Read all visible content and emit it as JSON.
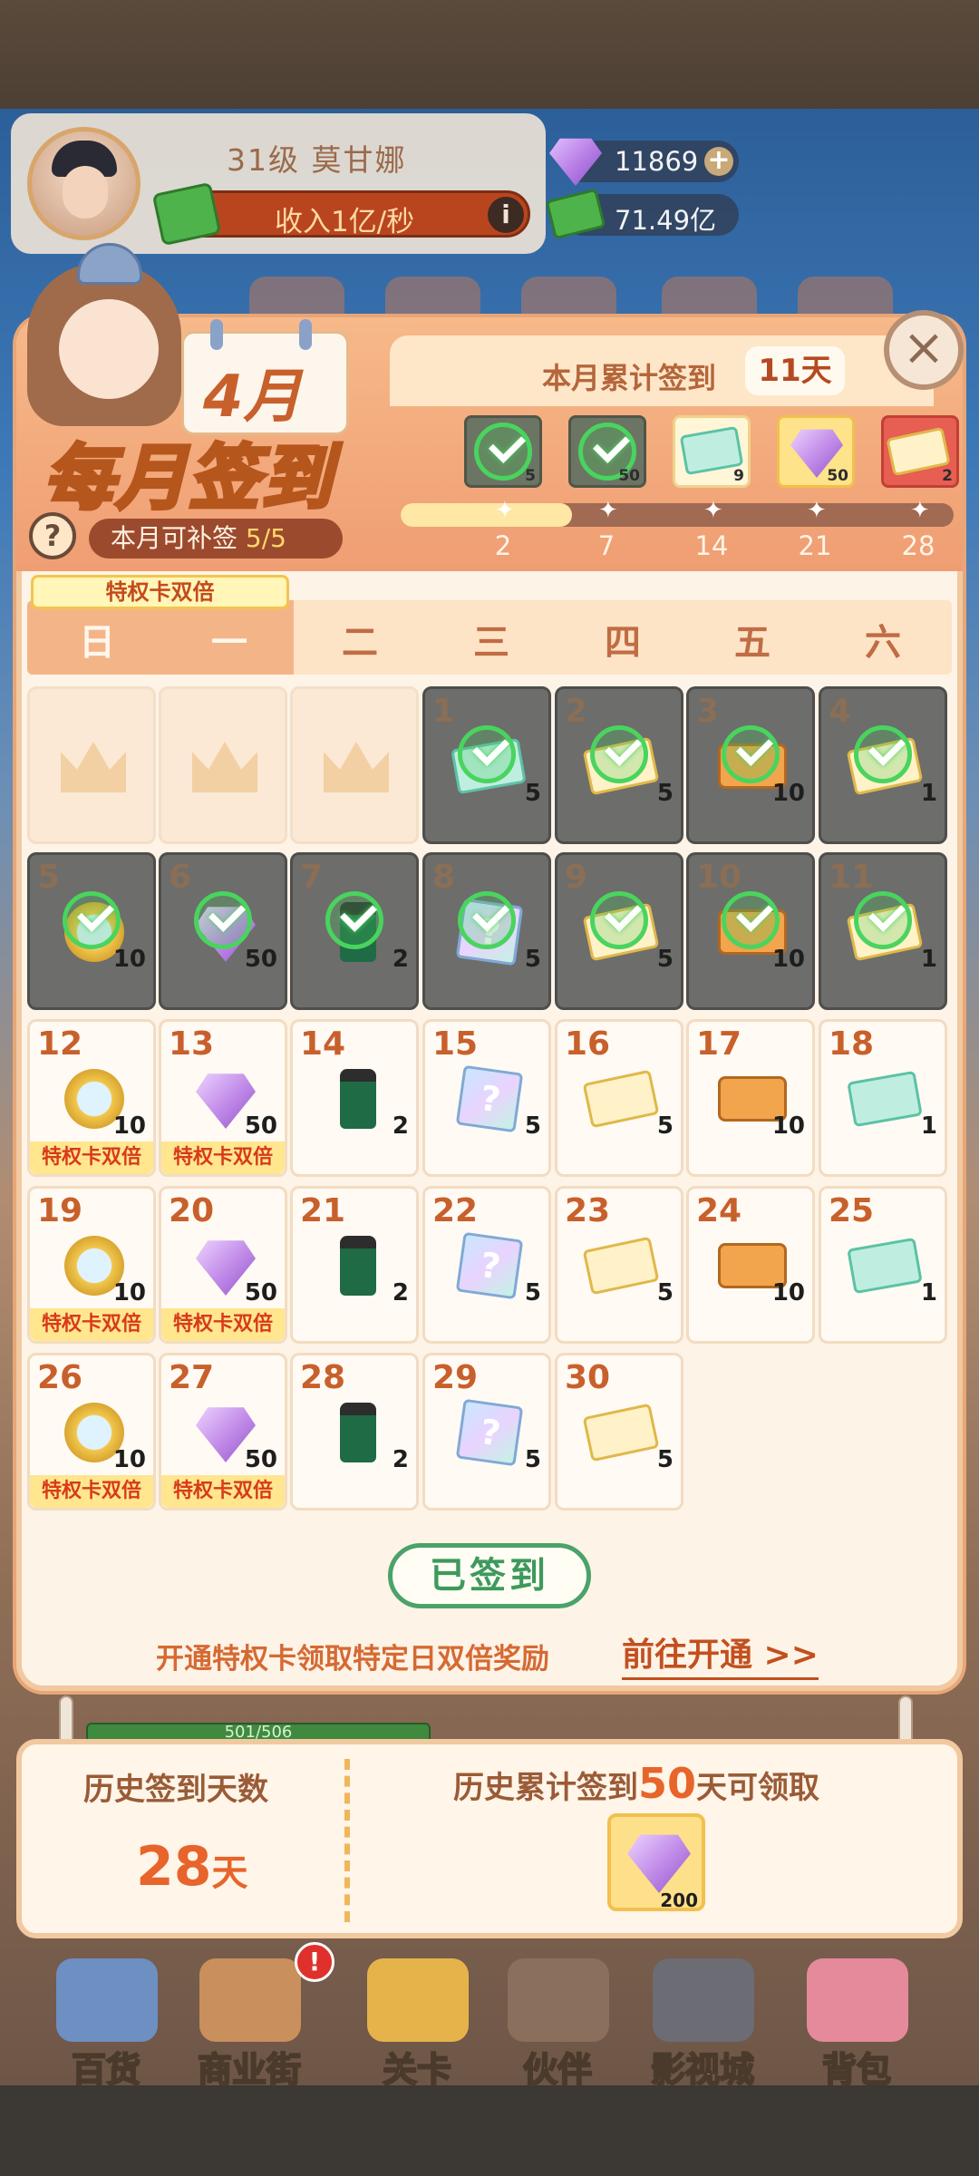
{
  "profile": {
    "level_name": "31级   莫甘娜",
    "income": "收入1亿/秒",
    "gems": "11869",
    "cash": "71.49亿"
  },
  "dialog": {
    "month": "4月",
    "title": "每月签到",
    "accum_label": "本月累计签到",
    "accum_days": "11天",
    "makeup_label": "本月可补签",
    "makeup_count": "5/5",
    "privilege_tag": "特权卡双倍",
    "close_icon": "×",
    "help_icon": "?"
  },
  "milestones": [
    {
      "day": "2",
      "count": "5",
      "type": "done"
    },
    {
      "day": "7",
      "count": "50",
      "type": "done"
    },
    {
      "day": "14",
      "count": "9",
      "type": "ticket"
    },
    {
      "day": "21",
      "count": "50",
      "type": "gem"
    },
    {
      "day": "28",
      "count": "2",
      "type": "red"
    }
  ],
  "progress": {
    "fraction": 0.31
  },
  "weekdays": [
    "日",
    "一",
    "二",
    "三",
    "四",
    "五",
    "六"
  ],
  "calendar": [
    {
      "day": "",
      "item": "crown",
      "qty": "",
      "state": "empty"
    },
    {
      "day": "",
      "item": "crown",
      "qty": "",
      "state": "empty"
    },
    {
      "day": "",
      "item": "crown",
      "qty": "",
      "state": "empty"
    },
    {
      "day": "1",
      "item": "cash-icon",
      "qty": "5",
      "state": "signed"
    },
    {
      "day": "2",
      "item": "ticket-icon",
      "qty": "5",
      "state": "signed"
    },
    {
      "day": "3",
      "item": "bento-icon",
      "qty": "10",
      "state": "signed"
    },
    {
      "day": "4",
      "item": "ticket-icon",
      "qty": "1",
      "state": "signed"
    },
    {
      "day": "5",
      "item": "clock-icon",
      "qty": "10",
      "state": "signed"
    },
    {
      "day": "6",
      "item": "gem-icon",
      "qty": "50",
      "state": "signed"
    },
    {
      "day": "7",
      "item": "bottle-icon",
      "qty": "2",
      "state": "signed"
    },
    {
      "day": "8",
      "item": "card-icon",
      "qty": "5",
      "state": "signed"
    },
    {
      "day": "9",
      "item": "ticket-icon",
      "qty": "5",
      "state": "signed"
    },
    {
      "day": "10",
      "item": "bento-icon",
      "qty": "10",
      "state": "signed"
    },
    {
      "day": "11",
      "item": "ticket-icon",
      "qty": "1",
      "state": "signed"
    },
    {
      "day": "12",
      "item": "clock-icon",
      "qty": "10",
      "state": "priv"
    },
    {
      "day": "13",
      "item": "gem-icon",
      "qty": "50",
      "state": "priv"
    },
    {
      "day": "14",
      "item": "bottle-icon",
      "qty": "2",
      "state": "open"
    },
    {
      "day": "15",
      "item": "card-icon",
      "qty": "5",
      "state": "open"
    },
    {
      "day": "16",
      "item": "ticket-icon",
      "qty": "5",
      "state": "open"
    },
    {
      "day": "17",
      "item": "bento-icon",
      "qty": "10",
      "state": "open"
    },
    {
      "day": "18",
      "item": "teal-ticket-icon",
      "qty": "1",
      "state": "open"
    },
    {
      "day": "19",
      "item": "clock-icon",
      "qty": "10",
      "state": "priv"
    },
    {
      "day": "20",
      "item": "gem-icon",
      "qty": "50",
      "state": "priv"
    },
    {
      "day": "21",
      "item": "bottle-icon",
      "qty": "2",
      "state": "open"
    },
    {
      "day": "22",
      "item": "card-icon",
      "qty": "5",
      "state": "open"
    },
    {
      "day": "23",
      "item": "ticket-icon",
      "qty": "5",
      "state": "open"
    },
    {
      "day": "24",
      "item": "bento-icon",
      "qty": "10",
      "state": "open"
    },
    {
      "day": "25",
      "item": "teal-ticket-icon",
      "qty": "1",
      "state": "open"
    },
    {
      "day": "26",
      "item": "clock-icon",
      "qty": "10",
      "state": "priv"
    },
    {
      "day": "27",
      "item": "gem-icon",
      "qty": "50",
      "state": "priv"
    },
    {
      "day": "28",
      "item": "bottle-icon",
      "qty": "2",
      "state": "open"
    },
    {
      "day": "29",
      "item": "card-icon",
      "qty": "5",
      "state": "open"
    },
    {
      "day": "30",
      "item": "ticket-icon",
      "qty": "5",
      "state": "open"
    }
  ],
  "privilege_strip": "特权卡双倍",
  "signed_button": "已签到",
  "promo": {
    "text": "开通特权卡领取特定日双倍奖励",
    "link": "前往开通 >>"
  },
  "history": {
    "label": "历史签到天数",
    "days": "28",
    "unit": "天",
    "goal_prefix": "历史累计签到",
    "goal_days": "50",
    "goal_suffix": "天可领取",
    "reward_qty": "200"
  },
  "scene_bar": "501/506",
  "nav": [
    {
      "label": "百货",
      "color": "#6d8fc2"
    },
    {
      "label": "商业街",
      "color": "#c98f5c"
    },
    {
      "label": "关卡",
      "color": "#e6b34a"
    },
    {
      "label": "伙伴",
      "color": "#8a6f5c"
    },
    {
      "label": "影视城",
      "color": "#6c6c74"
    },
    {
      "label": "背包",
      "color": "#e58a9a"
    }
  ],
  "nav_badge": "!"
}
